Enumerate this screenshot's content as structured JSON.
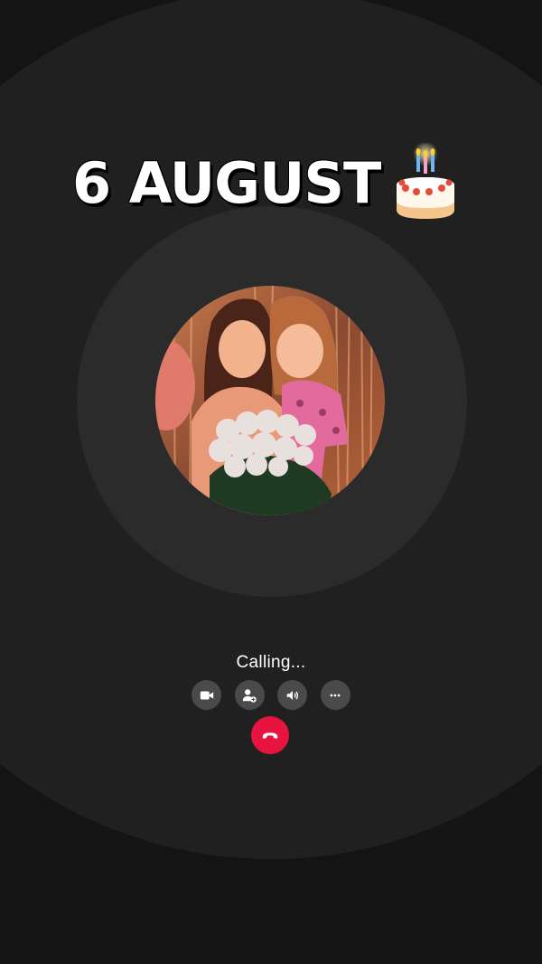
{
  "headline": {
    "text": "6 AUGUST",
    "emoji": "birthday-cake-icon"
  },
  "contact": {
    "photo": "profile-photo"
  },
  "call": {
    "status": "Calling...",
    "controls": [
      "video-camera-icon",
      "add-person-icon",
      "speaker-icon",
      "more-icon"
    ],
    "end_call": "end-call-icon"
  },
  "colors": {
    "background": "#141414",
    "outer_ring": "#202020",
    "inner_ring": "#2b2b2b",
    "control_button": "#4a4a4a",
    "end_call": "#e7143f"
  }
}
